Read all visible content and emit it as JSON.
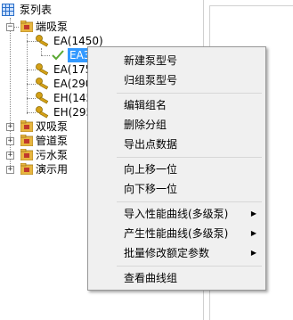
{
  "tree": {
    "root_label": "泵列表",
    "groups": [
      {
        "label": "端吸泵",
        "expanded": true
      },
      {
        "label": "双吸泵",
        "expanded": false
      },
      {
        "label": "管道泵",
        "expanded": false
      },
      {
        "label": "污水泵",
        "expanded": false
      },
      {
        "label": "演示用",
        "expanded": false
      }
    ],
    "models": [
      "EA(1450)",
      "EA(175",
      "EA(290",
      "EH(145",
      "EH(295"
    ],
    "selected_item": "EA3"
  },
  "context_menu": {
    "items": [
      {
        "label": "新建泵型号"
      },
      {
        "label": "归组泵型号"
      },
      {
        "label": "编辑组名"
      },
      {
        "label": "删除分组"
      },
      {
        "label": "导出点数据"
      },
      {
        "label": "向上移一位"
      },
      {
        "label": "向下移一位"
      },
      {
        "label": "导入性能曲线(多级泵)",
        "submenu_icon": "chevron-right-icon"
      },
      {
        "label": "产生性能曲线(多级泵)",
        "submenu_icon": "chevron-right-icon"
      },
      {
        "label": "批量修改额定参数",
        "submenu_icon": "chevron-right-icon"
      },
      {
        "label": "查看曲线组"
      }
    ]
  },
  "icons": {
    "root": "grid-icon",
    "group": "folder-icon",
    "model": "key-icon",
    "leaf": "checkmark-icon",
    "submenu": "chevron-right-icon"
  },
  "colors": {
    "selection": "#3399ff",
    "folder": "#e8b640",
    "key": "#d4a017",
    "checkmark": "#5aa832",
    "grid_icon": "#2a6fc9"
  }
}
